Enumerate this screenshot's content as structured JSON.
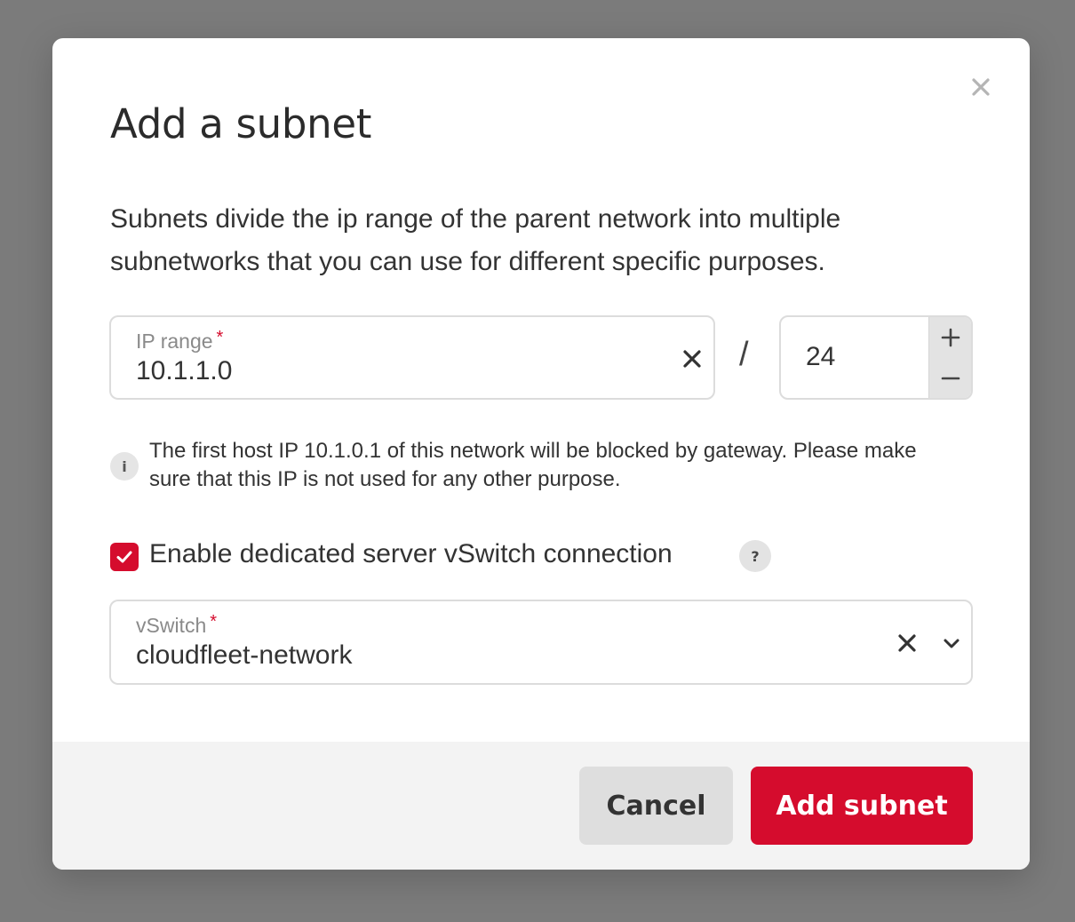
{
  "dialog": {
    "title": "Add a subnet",
    "description": "Subnets divide the ip range of the parent network into multiple subnetworks that you can use for different specific purposes."
  },
  "ip_range": {
    "label": "IP range",
    "required_mark": "*",
    "value": "10.1.1.0",
    "clear_icon": "close-icon"
  },
  "separator": "/",
  "prefix": {
    "value": "24",
    "increment_icon": "plus-icon",
    "decrement_icon": "minus-icon"
  },
  "info": {
    "icon": "i",
    "text": "The first host IP 10.1.0.1 of this network will be blocked by gateway. Please make sure that this IP is not used for any other purpose."
  },
  "vswitch_toggle": {
    "label": "Enable dedicated server vSwitch connection",
    "checked": true,
    "help_icon": "?"
  },
  "vswitch": {
    "label": "vSwitch",
    "required_mark": "*",
    "value": "cloudfleet-network"
  },
  "footer": {
    "cancel_label": "Cancel",
    "submit_label": "Add subnet"
  },
  "colors": {
    "accent": "#d50c2d",
    "overlay": "#7b7b7b",
    "footer_bg": "#f3f3f3"
  }
}
